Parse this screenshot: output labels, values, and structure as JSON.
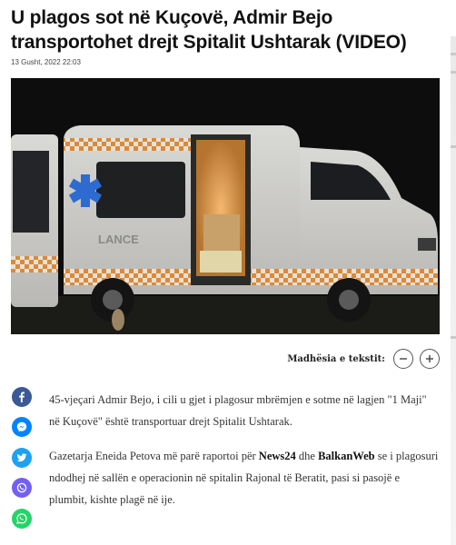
{
  "article": {
    "headline": "U plagos sot në Kuçovë, Admir Bejo transportohet drejt Spitalit Ushtarak (VIDEO)",
    "date": "13 Gusht, 2022 22:03",
    "photo_text": "LANCE",
    "paragraph1": "45-vjeçari Admir Bejo, i cili u gjet i plagosur mbrëmjen e sotme në lagjen \"1 Maji\" në Kuçovë\" është transportuar drejt Spitalit Ushtarak.",
    "paragraph2_before": "Gazetarja Eneida Petova më parë raportoi për ",
    "paragraph2_link1": "News24",
    "paragraph2_mid": " dhe ",
    "paragraph2_link2": "BalkanWeb",
    "paragraph2_after": " se i plagosuri ndodhej në sallën e operacionin në spitalin Rajonal të Beratit, pasi si pasojë e plumbit, kishte plagë në ije."
  },
  "font_size_control": {
    "label": "Madhësia e tekstit:",
    "decrease_icon": "minus-icon",
    "increase_icon": "plus-icon"
  },
  "share": {
    "items": [
      {
        "name": "facebook",
        "icon": "facebook-icon",
        "color": "#3b5998"
      },
      {
        "name": "messenger",
        "icon": "messenger-icon",
        "color": "#0084ff"
      },
      {
        "name": "twitter",
        "icon": "twitter-icon",
        "color": "#1da1f2"
      },
      {
        "name": "viber",
        "icon": "viber-icon",
        "color": "#7360f2"
      },
      {
        "name": "whatsapp",
        "icon": "whatsapp-icon",
        "color": "#25d366"
      }
    ]
  },
  "colors": {
    "text": "#333333",
    "headline": "#121212",
    "ambulance_orange": "#e8862a"
  }
}
